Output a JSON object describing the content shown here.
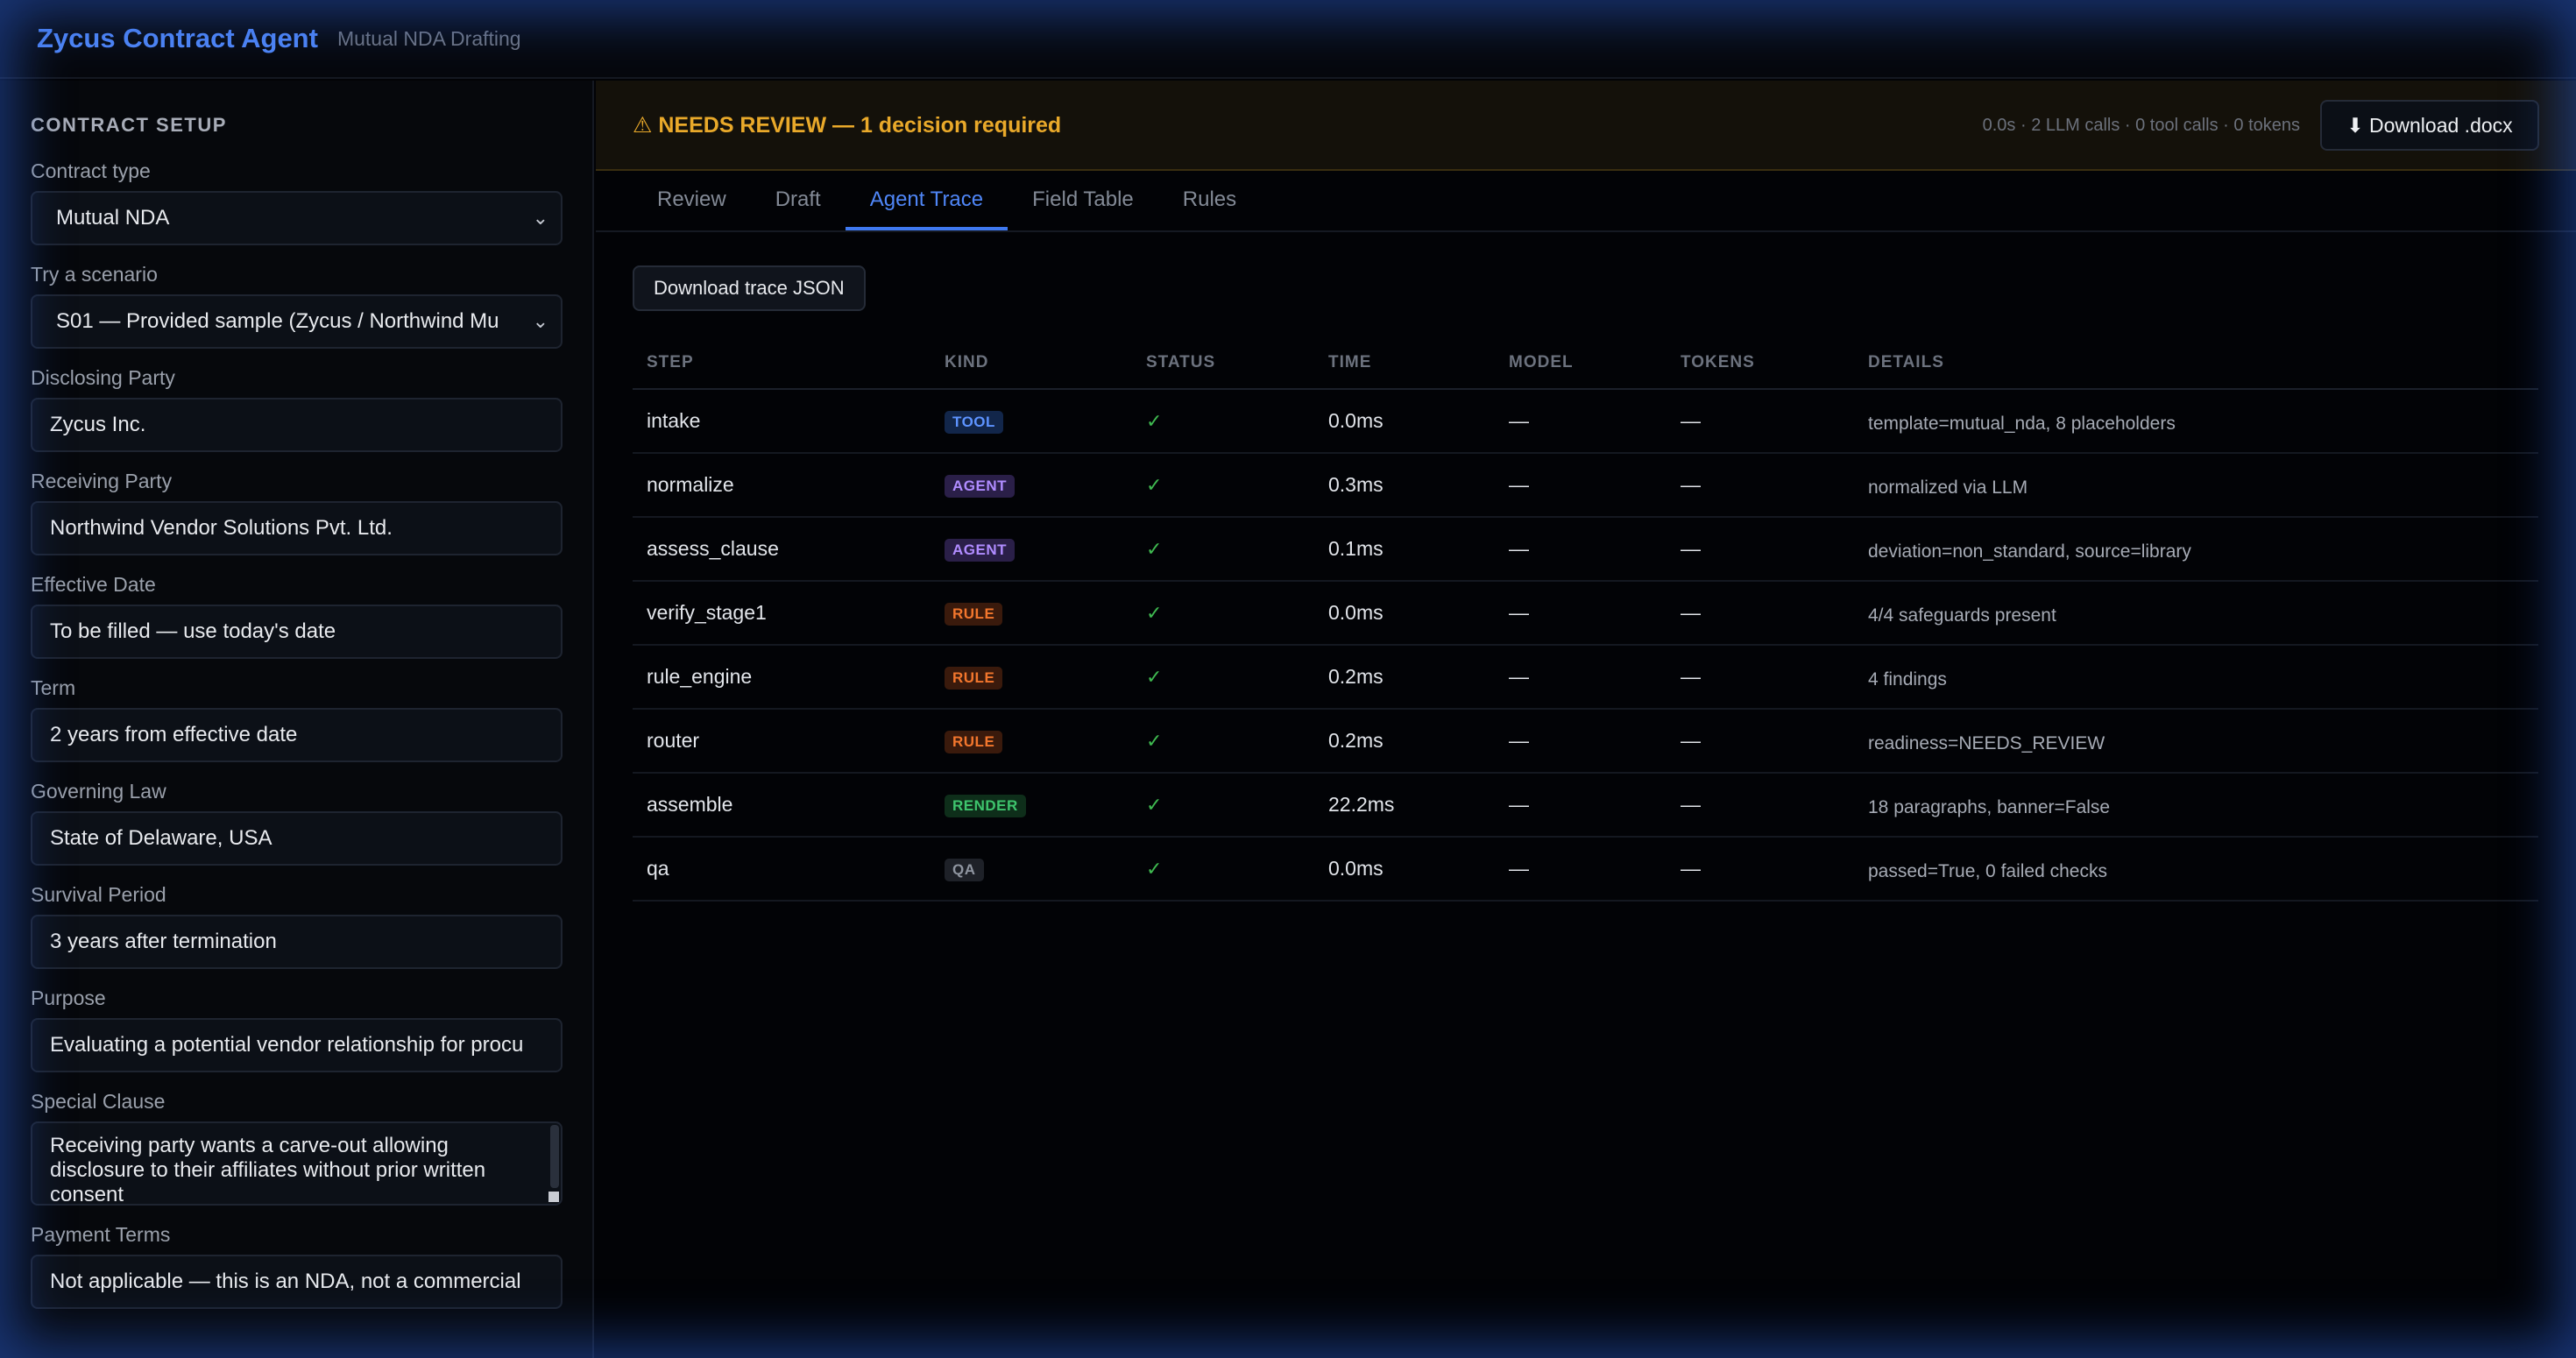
{
  "header": {
    "title": "Zycus Contract Agent",
    "subtitle": "Mutual NDA Drafting"
  },
  "sidebar": {
    "section_title": "CONTRACT SETUP",
    "contract_type": {
      "label": "Contract type",
      "value": "Mutual NDA"
    },
    "scenario": {
      "label": "Try a scenario",
      "value": "S01 — Provided sample (Zycus / Northwind Mu"
    },
    "disclosing_party": {
      "label": "Disclosing Party",
      "value": "Zycus Inc."
    },
    "receiving_party": {
      "label": "Receiving Party",
      "value": "Northwind Vendor Solutions Pvt. Ltd."
    },
    "effective_date": {
      "label": "Effective Date",
      "value": "To be filled — use today's date"
    },
    "term": {
      "label": "Term",
      "value": "2 years from effective date"
    },
    "governing_law": {
      "label": "Governing Law",
      "value": "State of Delaware, USA"
    },
    "survival_period": {
      "label": "Survival Period",
      "value": "3 years after termination"
    },
    "purpose": {
      "label": "Purpose",
      "value": "Evaluating a potential vendor relationship for procu"
    },
    "special_clause": {
      "label": "Special Clause",
      "value": "Receiving party wants a carve-out allowing disclosure to their affiliates without prior written consent"
    },
    "payment_terms": {
      "label": "Payment Terms",
      "value": "Not applicable — this is an NDA, not a commercial"
    }
  },
  "banner": {
    "text": "⚠ NEEDS REVIEW — 1 decision required",
    "stats": "0.0s · 2 LLM calls · 0 tool calls · 0 tokens",
    "download_label": "⬇ Download .docx"
  },
  "tabs": [
    "Review",
    "Draft",
    "Agent Trace",
    "Field Table",
    "Rules"
  ],
  "active_tab": "Agent Trace",
  "trace": {
    "download_label": "Download trace JSON",
    "columns": [
      "STEP",
      "KIND",
      "STATUS",
      "TIME",
      "MODEL",
      "TOKENS",
      "DETAILS"
    ],
    "rows": [
      {
        "step": "intake",
        "kind": "TOOL",
        "status": "✓",
        "time": "0.0ms",
        "model": "—",
        "tokens": "—",
        "details": "template=mutual_nda, 8 placeholders"
      },
      {
        "step": "normalize",
        "kind": "AGENT",
        "status": "✓",
        "time": "0.3ms",
        "model": "—",
        "tokens": "—",
        "details": "normalized via LLM"
      },
      {
        "step": "assess_clause",
        "kind": "AGENT",
        "status": "✓",
        "time": "0.1ms",
        "model": "—",
        "tokens": "—",
        "details": "deviation=non_standard, source=library"
      },
      {
        "step": "verify_stage1",
        "kind": "RULE",
        "status": "✓",
        "time": "0.0ms",
        "model": "—",
        "tokens": "—",
        "details": "4/4 safeguards present"
      },
      {
        "step": "rule_engine",
        "kind": "RULE",
        "status": "✓",
        "time": "0.2ms",
        "model": "—",
        "tokens": "—",
        "details": "4 findings"
      },
      {
        "step": "router",
        "kind": "RULE",
        "status": "✓",
        "time": "0.2ms",
        "model": "—",
        "tokens": "—",
        "details": "readiness=NEEDS_REVIEW"
      },
      {
        "step": "assemble",
        "kind": "RENDER",
        "status": "✓",
        "time": "22.2ms",
        "model": "—",
        "tokens": "—",
        "details": "18 paragraphs, banner=False"
      },
      {
        "step": "qa",
        "kind": "QA",
        "status": "✓",
        "time": "0.0ms",
        "model": "—",
        "tokens": "—",
        "details": "passed=True, 0 failed checks"
      }
    ]
  },
  "colors": {
    "accent": "#4f86f7",
    "warning": "#e9a92a",
    "success": "#3fb950"
  }
}
